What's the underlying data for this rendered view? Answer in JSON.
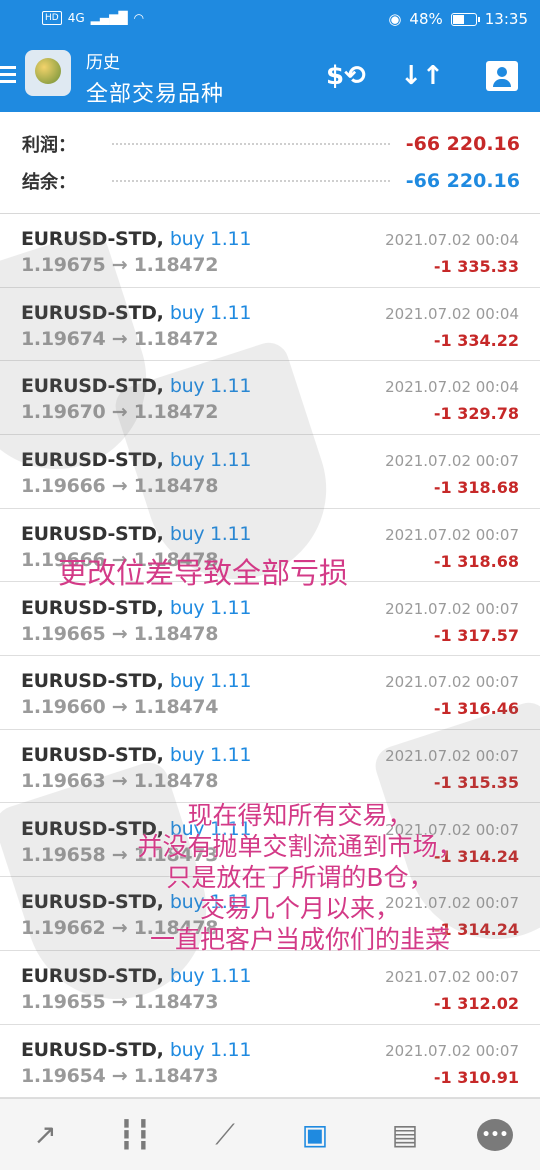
{
  "status_bar": {
    "hd": "HD",
    "network": "4G",
    "battery": "48%",
    "time": "13:35"
  },
  "header": {
    "subtitle": "历史",
    "title": "全部交易品种",
    "icons": [
      "dollar-sync-icon",
      "sort-arrows-icon",
      "contact-icon"
    ]
  },
  "summary": {
    "profit_label": "利润：",
    "profit_value": "-66 220.16",
    "balance_label": "结余：",
    "balance_value": "-66 220.16"
  },
  "deals": [
    {
      "symbol": "EURUSD-STD,",
      "action": "buy 1.11",
      "prices": "1.19675 → 1.18472",
      "time": "2021.07.02 00:04",
      "profit": "-1 335.33"
    },
    {
      "symbol": "EURUSD-STD,",
      "action": "buy 1.11",
      "prices": "1.19674 → 1.18472",
      "time": "2021.07.02 00:04",
      "profit": "-1 334.22"
    },
    {
      "symbol": "EURUSD-STD,",
      "action": "buy 1.11",
      "prices": "1.19670 → 1.18472",
      "time": "2021.07.02 00:04",
      "profit": "-1 329.78"
    },
    {
      "symbol": "EURUSD-STD,",
      "action": "buy 1.11",
      "prices": "1.19666 → 1.18478",
      "time": "2021.07.02 00:07",
      "profit": "-1 318.68"
    },
    {
      "symbol": "EURUSD-STD,",
      "action": "buy 1.11",
      "prices": "1.19666 → 1.18478",
      "time": "2021.07.02 00:07",
      "profit": "-1 318.68"
    },
    {
      "symbol": "EURUSD-STD,",
      "action": "buy 1.11",
      "prices": "1.19665 → 1.18478",
      "time": "2021.07.02 00:07",
      "profit": "-1 317.57"
    },
    {
      "symbol": "EURUSD-STD,",
      "action": "buy 1.11",
      "prices": "1.19660 → 1.18474",
      "time": "2021.07.02 00:07",
      "profit": "-1 316.46"
    },
    {
      "symbol": "EURUSD-STD,",
      "action": "buy 1.11",
      "prices": "1.19663 → 1.18478",
      "time": "2021.07.02 00:07",
      "profit": "-1 315.35"
    },
    {
      "symbol": "EURUSD-STD,",
      "action": "buy 1.11",
      "prices": "1.19658 → 1.18473",
      "time": "2021.07.02 00:07",
      "profit": "-1 314.24"
    },
    {
      "symbol": "EURUSD-STD,",
      "action": "buy 1.11",
      "prices": "1.19662 → 1.18478",
      "time": "2021.07.02 00:07",
      "profit": "-1 314.24"
    },
    {
      "symbol": "EURUSD-STD,",
      "action": "buy 1.11",
      "prices": "1.19655 → 1.18473",
      "time": "2021.07.02 00:07",
      "profit": "-1 312.02"
    },
    {
      "symbol": "EURUSD-STD,",
      "action": "buy 1.11",
      "prices": "1.19654 → 1.18473",
      "time": "2021.07.02 00:07",
      "profit": "-1 310.91"
    }
  ],
  "overlay": {
    "line1": "更改位差导致全部亏损",
    "lines": [
      "现在得知所有交易，",
      "并没有抛单交割流通到市场，",
      "只是放在了所谓的B仓，",
      "交易几个月以来，",
      "一直把客户当成你们的韭菜"
    ]
  },
  "bottom_nav": [
    {
      "name": "quotes-icon",
      "glyph": "⇄"
    },
    {
      "name": "chart-icon",
      "glyph": "⫽"
    },
    {
      "name": "trade-icon",
      "glyph": "↗"
    },
    {
      "name": "history-icon",
      "glyph": "▣"
    },
    {
      "name": "news-icon",
      "glyph": "▤"
    },
    {
      "name": "messages-icon",
      "glyph": "•••"
    }
  ],
  "colors": {
    "header_bg": "#1f8ae0",
    "accent_blue": "#1f8ae0",
    "loss_red": "#c62828",
    "overlay_pink": "#d33a87"
  }
}
